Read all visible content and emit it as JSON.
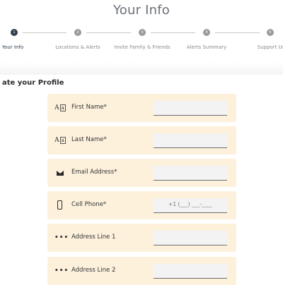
{
  "page": {
    "title": "Your Info"
  },
  "stepper": {
    "steps": [
      {
        "number": "1",
        "label": "Your Info",
        "active": true
      },
      {
        "number": "2",
        "label": "Locations & Alerts",
        "active": false
      },
      {
        "number": "3",
        "label": "Invite Family & Friends",
        "active": false
      },
      {
        "number": "4",
        "label": "Alerts Summary",
        "active": false
      },
      {
        "number": "5",
        "label": "Support Us",
        "active": false
      }
    ]
  },
  "section": {
    "title": "ate your Profile"
  },
  "fields": [
    {
      "icon": "font-size-icon",
      "label": "First Name*",
      "value": "",
      "placeholder": ""
    },
    {
      "icon": "font-size-icon",
      "label": "Last Name*",
      "value": "",
      "placeholder": ""
    },
    {
      "icon": "envelope-icon",
      "label": "Email Address*",
      "value": "",
      "placeholder": ""
    },
    {
      "icon": "phone-icon",
      "label": "Cell Phone*",
      "value": "",
      "placeholder": "+1 (___) ___-____"
    },
    {
      "icon": "more-dots-icon",
      "label": "Address Line 1",
      "value": "",
      "placeholder": ""
    },
    {
      "icon": "more-dots-icon",
      "label": "Address Line 2",
      "value": "",
      "placeholder": ""
    }
  ],
  "colors": {
    "field_bg": "#fdf1dc",
    "active_step": "#2f3d4d",
    "inactive_step": "#9a9a9a"
  }
}
